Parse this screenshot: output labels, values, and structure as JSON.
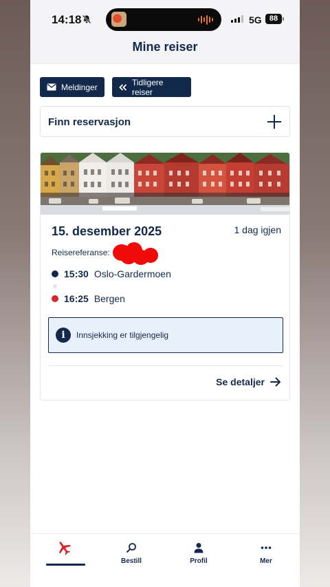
{
  "status_bar": {
    "time": "14:18",
    "network": "5G",
    "battery": "88"
  },
  "header": {
    "title": "Mine reiser"
  },
  "actions": {
    "messages": "Meldinger",
    "previous_trips": "Tidligere reiser"
  },
  "find_reservation": {
    "label": "Finn reservasjon"
  },
  "trip": {
    "date": "15. desember 2025",
    "days_left": "1 dag igjen",
    "reference_label": "Reisereferanse:",
    "departure": {
      "time": "15:30",
      "airport": "Oslo-Gardermoen"
    },
    "arrival": {
      "time": "16:25",
      "airport": "Bergen"
    },
    "checkin_notice": "Innsjekking er tilgjengelig",
    "details_link": "Se detaljer"
  },
  "tabs": [
    {
      "label": "",
      "icon": "plane-icon",
      "active": true
    },
    {
      "label": "Bestill",
      "icon": "search-icon"
    },
    {
      "label": "Profil",
      "icon": "person-icon"
    },
    {
      "label": "Mer",
      "icon": "more-icon"
    }
  ],
  "colors": {
    "navy": "#13294b",
    "red": "#d9232e",
    "info_bg": "#e8f0fa"
  }
}
